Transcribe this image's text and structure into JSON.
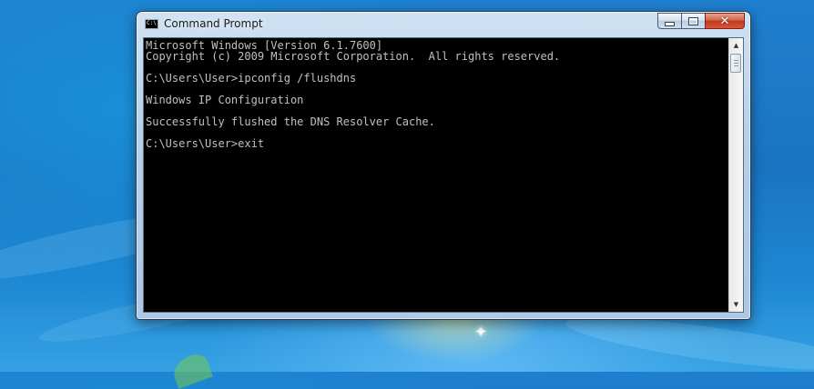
{
  "window": {
    "title": "Command Prompt",
    "icon": "cmd-icon",
    "icon_text": "C:\\",
    "buttons": {
      "minimize": "minimize-icon",
      "maximize": "maximize-icon",
      "close": "close-icon",
      "close_glyph": "✕"
    }
  },
  "console": {
    "lines": [
      "Microsoft Windows [Version 6.1.7600]",
      "Copyright (c) 2009 Microsoft Corporation.  All rights reserved.",
      "",
      "C:\\Users\\User>ipconfig /flushdns",
      "",
      "Windows IP Configuration",
      "",
      "Successfully flushed the DNS Resolver Cache.",
      "",
      "C:\\Users\\User>exit"
    ]
  },
  "scrollbar": {
    "up_glyph": "▲",
    "down_glyph": "▼"
  },
  "desktop": {
    "sparkle_glyph": "✦"
  },
  "colors": {
    "console_bg": "#000000",
    "console_text": "#c0c0c0",
    "close_button": "#c23a1e"
  }
}
